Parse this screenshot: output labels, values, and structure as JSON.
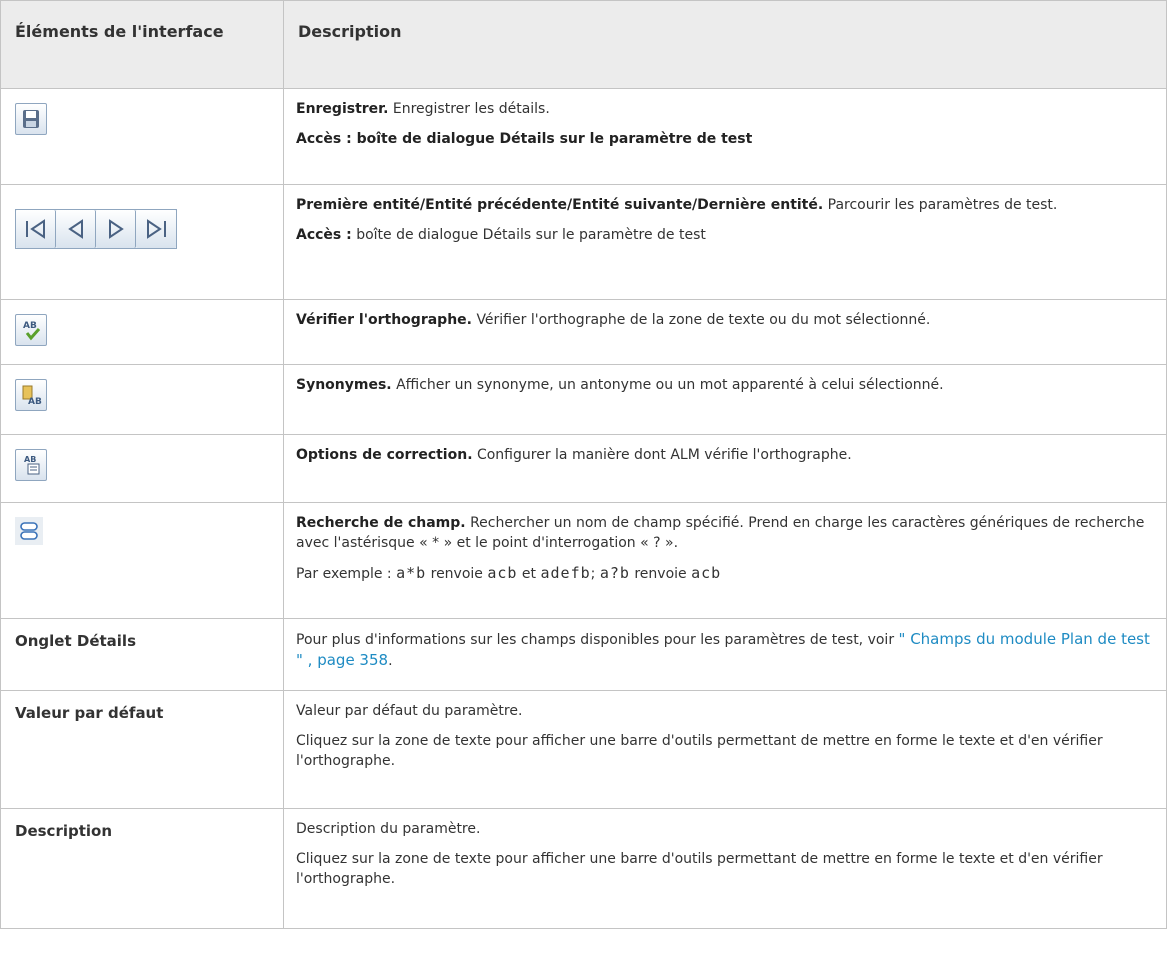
{
  "header": {
    "col1": "Éléments de l'interface",
    "col2": "Description"
  },
  "rows": {
    "save": {
      "icon": "save-icon",
      "title": "Enregistrer.",
      "text": "Enregistrer les détails.",
      "access": "Accès : boîte de dialogue Détails sur le paramètre de test"
    },
    "nav": {
      "icons": [
        "first-entity-icon",
        "previous-entity-icon",
        "next-entity-icon",
        "last-entity-icon"
      ],
      "title": "Première entité/Entité précédente/Entité suivante/Dernière entité.",
      "text": "Parcourir les paramètres de test.",
      "access_label": "Accès :",
      "access_text": "boîte de dialogue Détails sur le paramètre de test"
    },
    "spell": {
      "icon": "spell-check-icon",
      "title": "Vérifier l'orthographe.",
      "text": "Vérifier l'orthographe de la zone de texte ou du mot sélectionné."
    },
    "thesaurus": {
      "icon": "thesaurus-icon",
      "title": "Synonymes.",
      "text": "Afficher un synonyme, un antonyme ou un mot apparenté à celui sélectionné."
    },
    "options": {
      "icon": "spelling-options-icon",
      "title": "Options de correction.",
      "text": "Configurer la manière dont ALM vérifie l'orthographe."
    },
    "search": {
      "icon": "field-search-icon",
      "title": "Recherche de champ.",
      "text": "Rechercher un nom de champ spécifié. Prend en charge les caractères génériques de recherche avec l'astérisque « * » et le point d'interrogation « ? ».",
      "example_prefix": "Par exemple : ",
      "ex1": "a*b",
      "ex1_mid": " renvoie ",
      "ex1_res": "acb",
      "ex_and": "  et ",
      "ex1_res2": "adefb",
      "ex_sep": "; ",
      "ex2": "a?b",
      "ex2_mid": " renvoie ",
      "ex2_res": "acb"
    },
    "details": {
      "label": "Onglet Détails",
      "text": "Pour plus d'informations sur les champs disponibles pour les paramètres de test, voir ",
      "link": "\" Champs du module Plan de test \" , page 358",
      "end": "."
    },
    "default_value": {
      "label": "Valeur par défaut",
      "text1": "Valeur par défaut du paramètre.",
      "text2": "Cliquez sur la zone de texte pour afficher une barre d'outils permettant de mettre en forme le texte et d'en vérifier l'orthographe."
    },
    "description": {
      "label": "Description",
      "text1": "Description du paramètre.",
      "text2": "Cliquez sur la zone de texte pour afficher une barre d'outils permettant de mettre en forme le texte et d'en vérifier l'orthographe."
    }
  }
}
